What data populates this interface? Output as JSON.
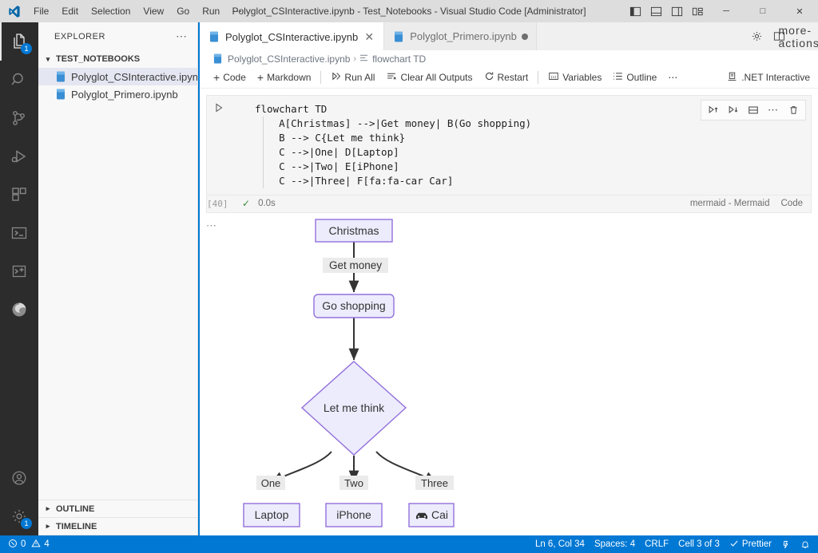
{
  "titlebar": {
    "logo_icon": "vscode-logo-icon",
    "menus": [
      {
        "label": "File"
      },
      {
        "label": "Edit"
      },
      {
        "label": "Selection"
      },
      {
        "label": "View"
      },
      {
        "label": "Go"
      },
      {
        "label": "Run"
      },
      {
        "label": "⋯"
      }
    ],
    "title": "Polyglot_CSInteractive.ipynb - Test_Notebooks - Visual Studio Code [Administrator]",
    "layout_buttons": [
      {
        "name": "toggle-primary-sidebar-icon"
      },
      {
        "name": "toggle-panel-icon"
      },
      {
        "name": "toggle-secondary-sidebar-icon"
      },
      {
        "name": "customize-layout-icon"
      }
    ],
    "window_controls": {
      "minimize": "─",
      "maximize": "□",
      "close": "✕"
    }
  },
  "activitybar": {
    "items": [
      {
        "name": "explorer",
        "icon": "files-icon",
        "active": true,
        "badge": "1"
      },
      {
        "name": "search",
        "icon": "search-icon",
        "active": false,
        "badge": ""
      },
      {
        "name": "source-control",
        "icon": "source-control-icon",
        "active": false,
        "badge": ""
      },
      {
        "name": "run-and-debug",
        "icon": "run-debug-icon",
        "active": false,
        "badge": ""
      },
      {
        "name": "extensions",
        "icon": "extensions-icon",
        "active": false,
        "badge": ""
      },
      {
        "name": "terminal",
        "icon": "terminal-icon",
        "active": false,
        "badge": ""
      },
      {
        "name": "polyglot-notebooks",
        "icon": "polyglot-terminal-icon",
        "active": false,
        "badge": ""
      },
      {
        "name": "edge-tools",
        "icon": "edge-browser-icon",
        "active": false,
        "badge": ""
      }
    ],
    "bottom_items": [
      {
        "name": "accounts",
        "icon": "account-icon",
        "badge": ""
      },
      {
        "name": "manage",
        "icon": "gear-icon",
        "badge": "1"
      }
    ]
  },
  "sidebar": {
    "header_title": "EXPLORER",
    "header_more": "⋯",
    "section_title": "TEST_NOTEBOOKS",
    "files": [
      {
        "label": "Polyglot_CSInteractive.ipynb",
        "selected": true,
        "icon": "notebook-file-icon"
      },
      {
        "label": "Polyglot_Primero.ipynb",
        "selected": false,
        "icon": "notebook-file-icon"
      }
    ],
    "bottom_panels": [
      {
        "label": "OUTLINE"
      },
      {
        "label": "TIMELINE"
      }
    ]
  },
  "editor": {
    "tabs": [
      {
        "label": "Polyglot_CSInteractive.ipynb",
        "active": true,
        "dirty": false,
        "close_glyph": "✕",
        "icon": "notebook-file-icon"
      },
      {
        "label": "Polyglot_Primero.ipynb",
        "active": false,
        "dirty": true,
        "close_glyph": "✕",
        "icon": "notebook-file-icon"
      }
    ],
    "tab_actions": [
      {
        "name": "notebook-settings-gear-icon"
      },
      {
        "name": "split-editor-icon"
      },
      {
        "name": "editor-more-actions-icon"
      }
    ],
    "breadcrumb": [
      {
        "label": "Polyglot_CSInteractive.ipynb",
        "icon": "notebook-file-icon"
      },
      {
        "label": "flowchart TD",
        "icon": "symbol-cell-icon"
      }
    ],
    "breadcrumb_separator": "›",
    "toolbar": {
      "buttons": [
        {
          "label": "Code",
          "icon": "plus-icon"
        },
        {
          "label": "Markdown",
          "icon": "plus-icon"
        },
        {
          "label": "Run All",
          "icon": "run-all-icon"
        },
        {
          "label": "Clear All Outputs",
          "icon": "clear-all-icon"
        },
        {
          "label": "Restart",
          "icon": "restart-icon"
        },
        {
          "label": "Variables",
          "icon": "variables-icon"
        },
        {
          "label": "Outline",
          "icon": "outline-icon"
        },
        {
          "label": "⋯",
          "icon": "more-icon"
        }
      ],
      "kernel_label": ".NET Interactive",
      "kernel_icon": "kernel-icon"
    }
  },
  "cell": {
    "run_icon": "run-cell-icon",
    "code_lines": [
      "flowchart TD",
      "    A[Christmas] -->|Get money| B(Go shopping)",
      "    B --> C{Let me think}",
      "    C -->|One| D[Laptop]",
      "    C -->|Two| E[iPhone]",
      "    C -->|Three| F[fa:fa-car Car]"
    ],
    "actions": [
      {
        "name": "execute-above-cells-icon",
        "glyph": "▷"
      },
      {
        "name": "execute-cell-and-below-icon",
        "glyph": "▷"
      },
      {
        "name": "split-cell-icon",
        "glyph": "▤"
      },
      {
        "name": "more-cell-actions-icon",
        "glyph": "⋯"
      },
      {
        "name": "delete-cell-icon",
        "glyph": "🗑"
      }
    ],
    "execution_count": "[40]",
    "status_check": "✓",
    "execution_time": "0.0s",
    "language": "mermaid - Mermaid",
    "cell_kind": "Code",
    "output_more": "⋯"
  },
  "chart_data": {
    "type": "diagram",
    "diagram_kind": "flowchart TD",
    "title": "flowchart TD",
    "colors": {
      "node_fill": "#ececfd",
      "node_stroke": "#9370db",
      "edge_stroke": "#333333",
      "label_bg": "#ebebeb",
      "text": "#333333"
    },
    "nodes": [
      {
        "id": "A",
        "label": "Christmas",
        "shape": "rect"
      },
      {
        "id": "B",
        "label": "Go shopping",
        "shape": "rounded"
      },
      {
        "id": "C",
        "label": "Let me think",
        "shape": "diamond"
      },
      {
        "id": "D",
        "label": "Laptop",
        "shape": "rect"
      },
      {
        "id": "E",
        "label": "iPhone",
        "shape": "rect"
      },
      {
        "id": "F",
        "label": "Car",
        "shape": "rect",
        "icon": "car-icon",
        "clipped_label": "Cai"
      }
    ],
    "edges": [
      {
        "from": "A",
        "to": "B",
        "label": "Get money"
      },
      {
        "from": "B",
        "to": "C",
        "label": ""
      },
      {
        "from": "C",
        "to": "D",
        "label": "One"
      },
      {
        "from": "C",
        "to": "E",
        "label": "Two"
      },
      {
        "from": "C",
        "to": "F",
        "label": "Three"
      }
    ]
  },
  "statusbar": {
    "errors": "0",
    "warnings": "4",
    "error_icon": "error-icon",
    "warning_icon": "warning-icon",
    "right_items": [
      {
        "label": "Ln 6, Col 34",
        "name": "cursor-position"
      },
      {
        "label": "Spaces: 4",
        "name": "indentation"
      },
      {
        "label": "CRLF",
        "name": "eol-sequence"
      },
      {
        "label": "Cell 3 of 3",
        "name": "cell-position"
      },
      {
        "label": "Prettier",
        "name": "prettier-status",
        "icon": "check-icon"
      }
    ],
    "remote_icon": "remote-indicator-icon",
    "bell_icon": "notifications-bell-icon"
  }
}
